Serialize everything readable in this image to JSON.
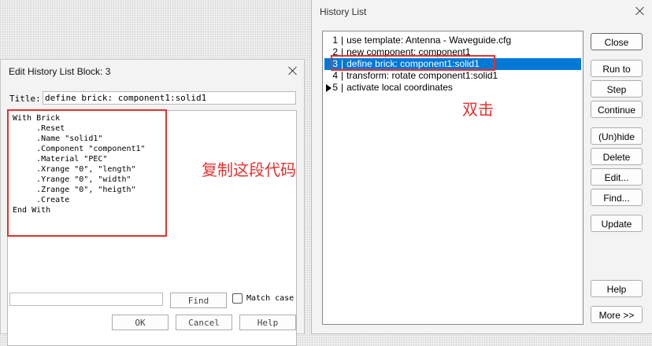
{
  "history_window": {
    "title": "History List",
    "items": [
      {
        "num": "1",
        "text": "use template: Antenna - Waveguide.cfg",
        "selected": false,
        "marker": false
      },
      {
        "num": "2",
        "text": "new component: component1",
        "selected": false,
        "marker": false
      },
      {
        "num": "3",
        "text": "define brick: component1:solid1",
        "selected": true,
        "marker": false
      },
      {
        "num": "4",
        "text": "transform: rotate component1:solid1",
        "selected": false,
        "marker": false
      },
      {
        "num": "5",
        "text": "activate local coordinates",
        "selected": false,
        "marker": true
      }
    ],
    "buttons": {
      "close": "Close",
      "run_to": "Run to",
      "step": "Step",
      "continue": "Continue",
      "unhide": "(Un)hide",
      "delete": "Delete",
      "edit": "Edit...",
      "find": "Find...",
      "update": "Update",
      "help": "Help",
      "more": "More >>"
    }
  },
  "edit_window": {
    "title": "Edit History List Block: 3",
    "title_label": "Title:",
    "title_value": "define brick: component1:solid1",
    "code": "With Brick\n     .Reset\n     .Name \"solid1\"\n     .Component \"component1\"\n     .Material \"PEC\"\n     .Xrange \"0\", \"length\"\n     .Yrange \"0\", \"width\"\n     .Zrange \"0\", \"heigth\"\n     .Create\nEnd With",
    "find_value": "",
    "buttons": {
      "find": "Find",
      "ok": "OK",
      "cancel": "Cancel",
      "help": "Help"
    },
    "match_case_label": "Match case"
  },
  "annotations": {
    "copy_code": "复制这段代码",
    "double_click": "双击"
  },
  "colors": {
    "selection": "#0078d7",
    "annotation": "#e53030"
  }
}
